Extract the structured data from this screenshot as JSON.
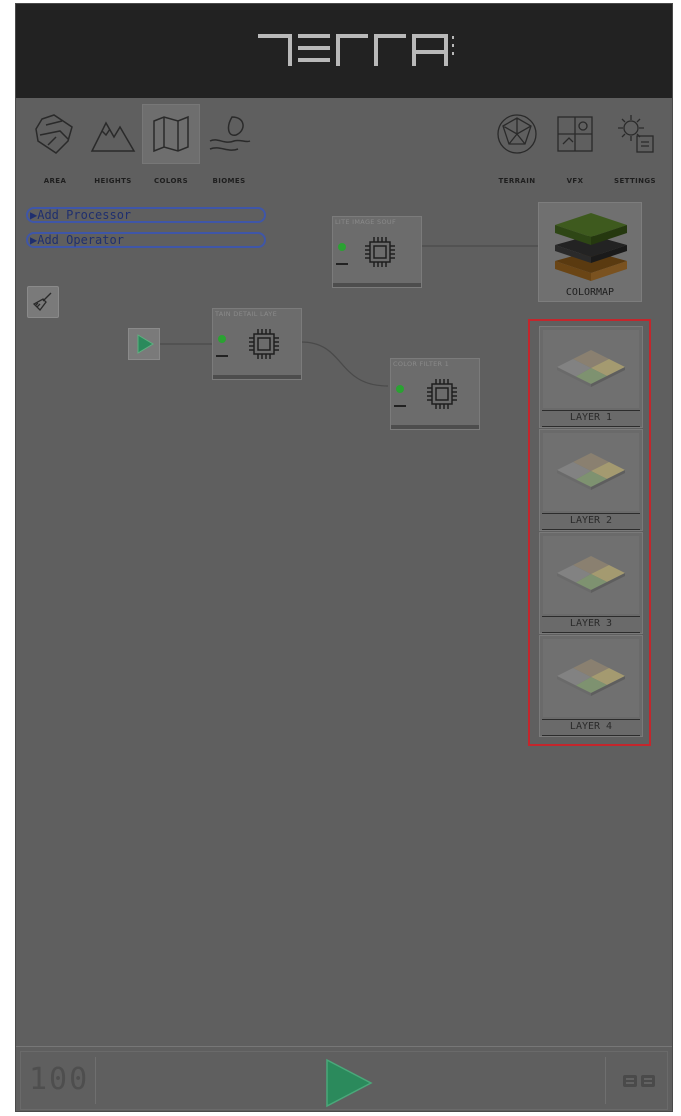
{
  "app": {
    "title": "TERRA"
  },
  "toolbar": {
    "left": [
      {
        "label": "AREA",
        "icon": "globe-map-icon"
      },
      {
        "label": "HEIGHTS",
        "icon": "mountains-icon"
      },
      {
        "label": "COLORS",
        "icon": "map-icon",
        "active": true
      },
      {
        "label": "BIOMES",
        "icon": "leaf-hand-icon"
      }
    ],
    "right": [
      {
        "label": "TERRAIN",
        "icon": "sphere-icon"
      },
      {
        "label": "VFX",
        "icon": "vfx-panel-icon"
      },
      {
        "label": "SETTINGS",
        "icon": "gear-icon"
      }
    ]
  },
  "graph": {
    "add_processor": "Add Processor",
    "add_operator": "Add Operator",
    "nodes": {
      "satellite": {
        "title": "LITE IMAGE SOUF"
      },
      "detail": {
        "title": "TAIN DETAIL LAYE"
      },
      "color_filter": {
        "title": "COLOR FILTER 1"
      }
    },
    "colormap": {
      "label": "COLORMAP"
    },
    "layers": [
      {
        "label": "LAYER 1"
      },
      {
        "label": "LAYER 2"
      },
      {
        "label": "LAYER 3"
      },
      {
        "label": "LAYER 4"
      }
    ]
  },
  "footer": {
    "counter": "100"
  },
  "colors": {
    "highlight": "#c4262c",
    "active_dot": "#2aa232",
    "button_outline": "#3f56a8",
    "play_fill": "#2b8a5c"
  }
}
